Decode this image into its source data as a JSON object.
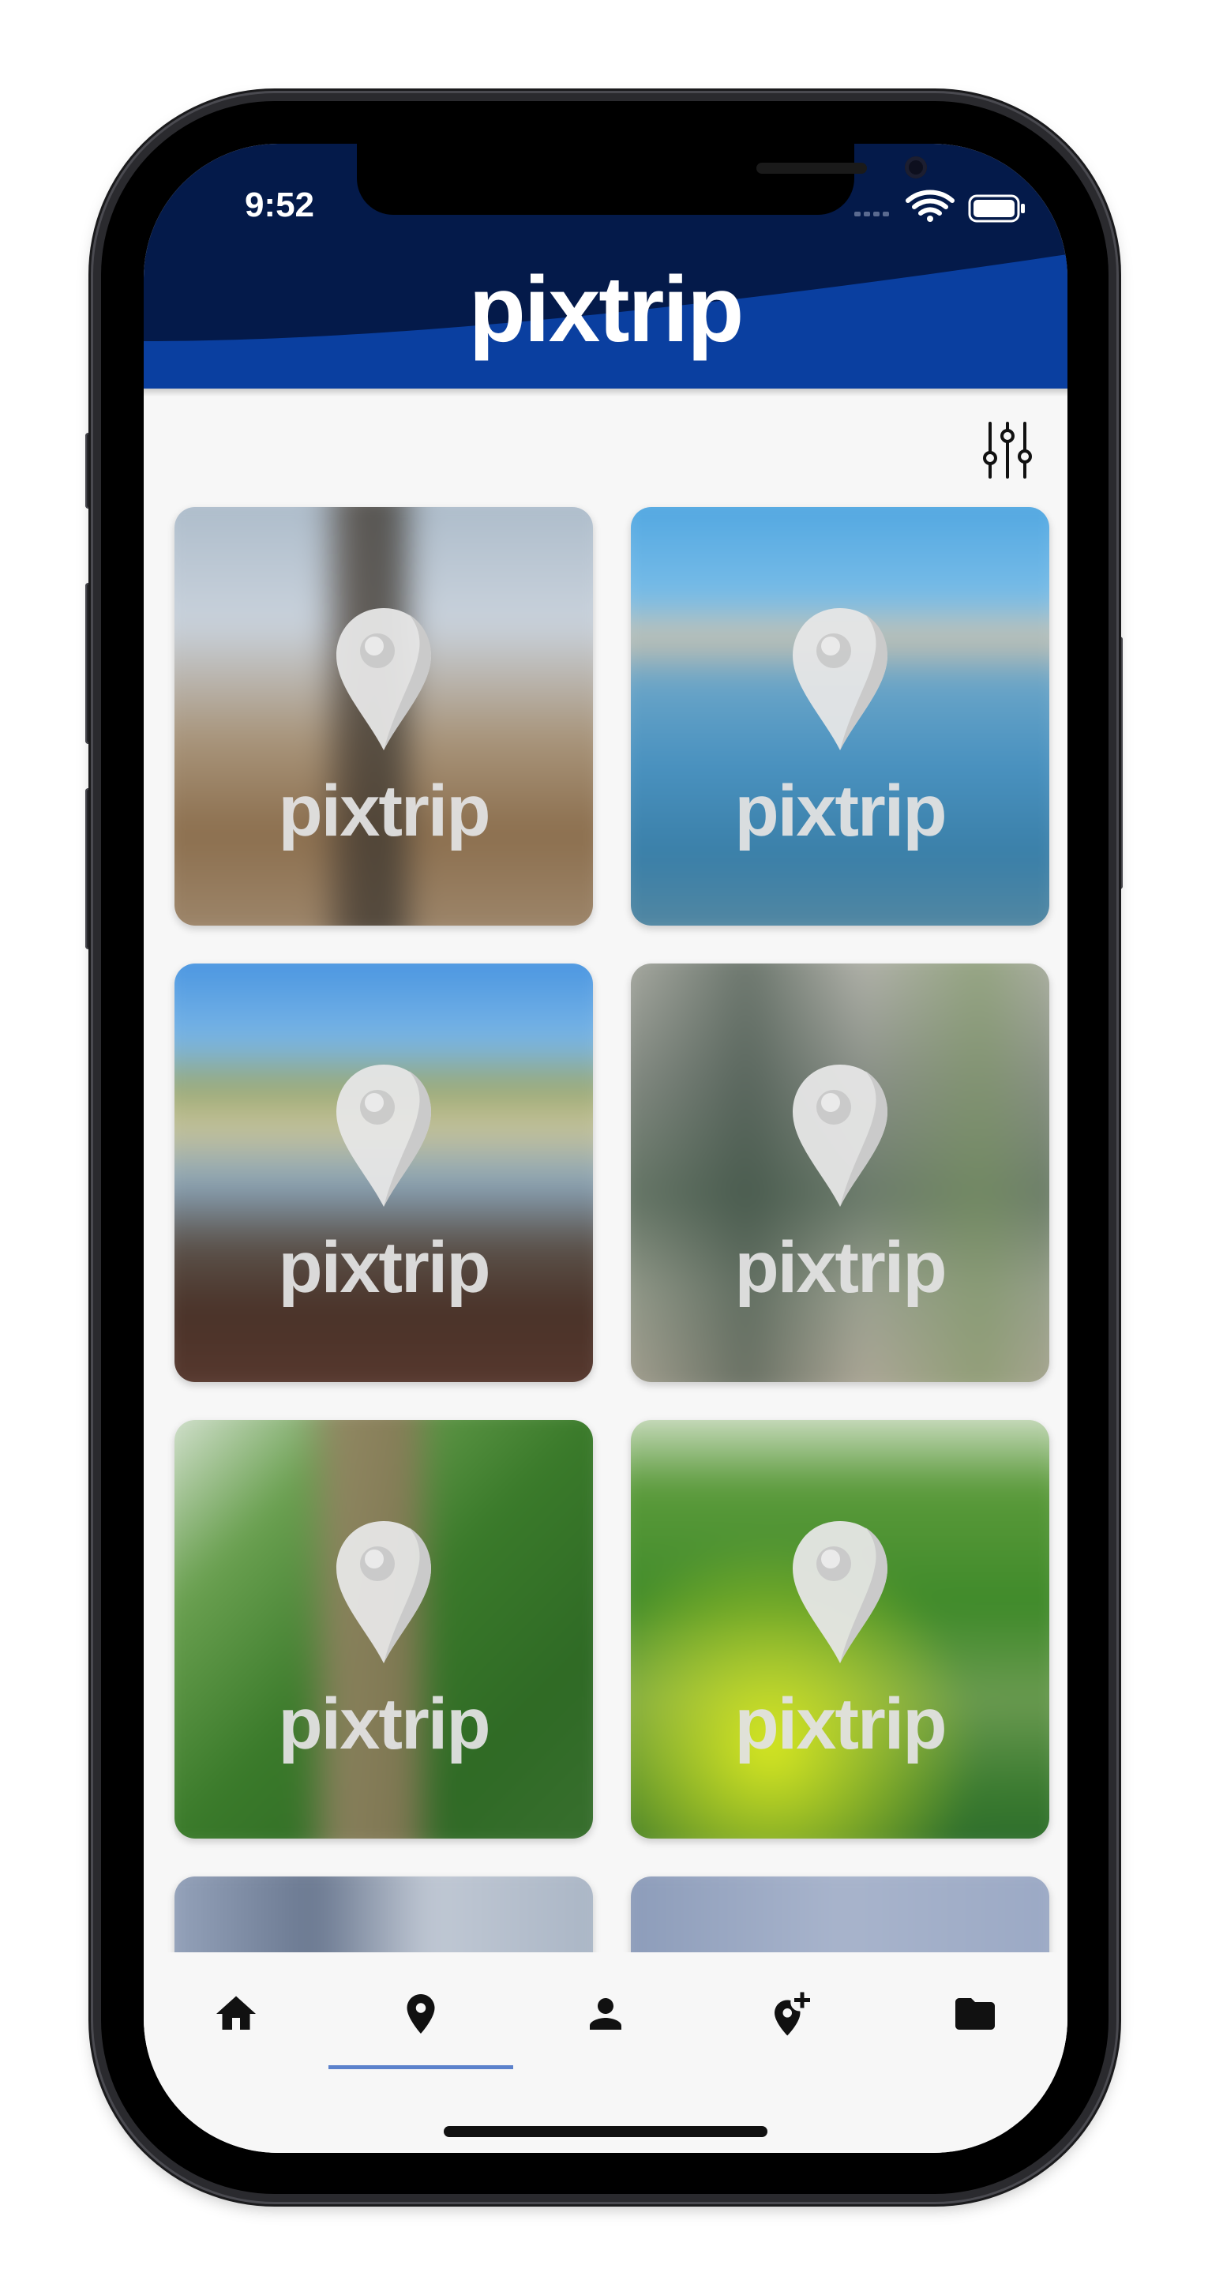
{
  "status_bar": {
    "time": "9:52",
    "icons": [
      "cellular-signal-icon",
      "wifi-icon",
      "battery-icon"
    ]
  },
  "app": {
    "title": "pixtrip",
    "colors": {
      "header_dark": "#041a4a",
      "header_blue": "#0a3fa0",
      "background": "#f7f7f7",
      "nav_indicator": "#5c82cc",
      "icon": "#111111"
    }
  },
  "toolbar": {
    "filter_icon": "sliders-icon"
  },
  "grid": {
    "tiles": [
      {
        "brand": "pixtrip",
        "icon": "map-pin-icon"
      },
      {
        "brand": "pixtrip",
        "icon": "map-pin-icon"
      },
      {
        "brand": "pixtrip",
        "icon": "map-pin-icon"
      },
      {
        "brand": "pixtrip",
        "icon": "map-pin-icon"
      },
      {
        "brand": "pixtrip",
        "icon": "map-pin-icon"
      },
      {
        "brand": "pixtrip",
        "icon": "map-pin-icon"
      },
      {
        "brand": "",
        "icon": ""
      },
      {
        "brand": "",
        "icon": ""
      }
    ]
  },
  "bottom_nav": {
    "active_index": 1,
    "items": [
      {
        "icon": "home-icon"
      },
      {
        "icon": "map-pin-icon"
      },
      {
        "icon": "person-icon"
      },
      {
        "icon": "add-location-icon"
      },
      {
        "icon": "folder-icon"
      }
    ]
  }
}
